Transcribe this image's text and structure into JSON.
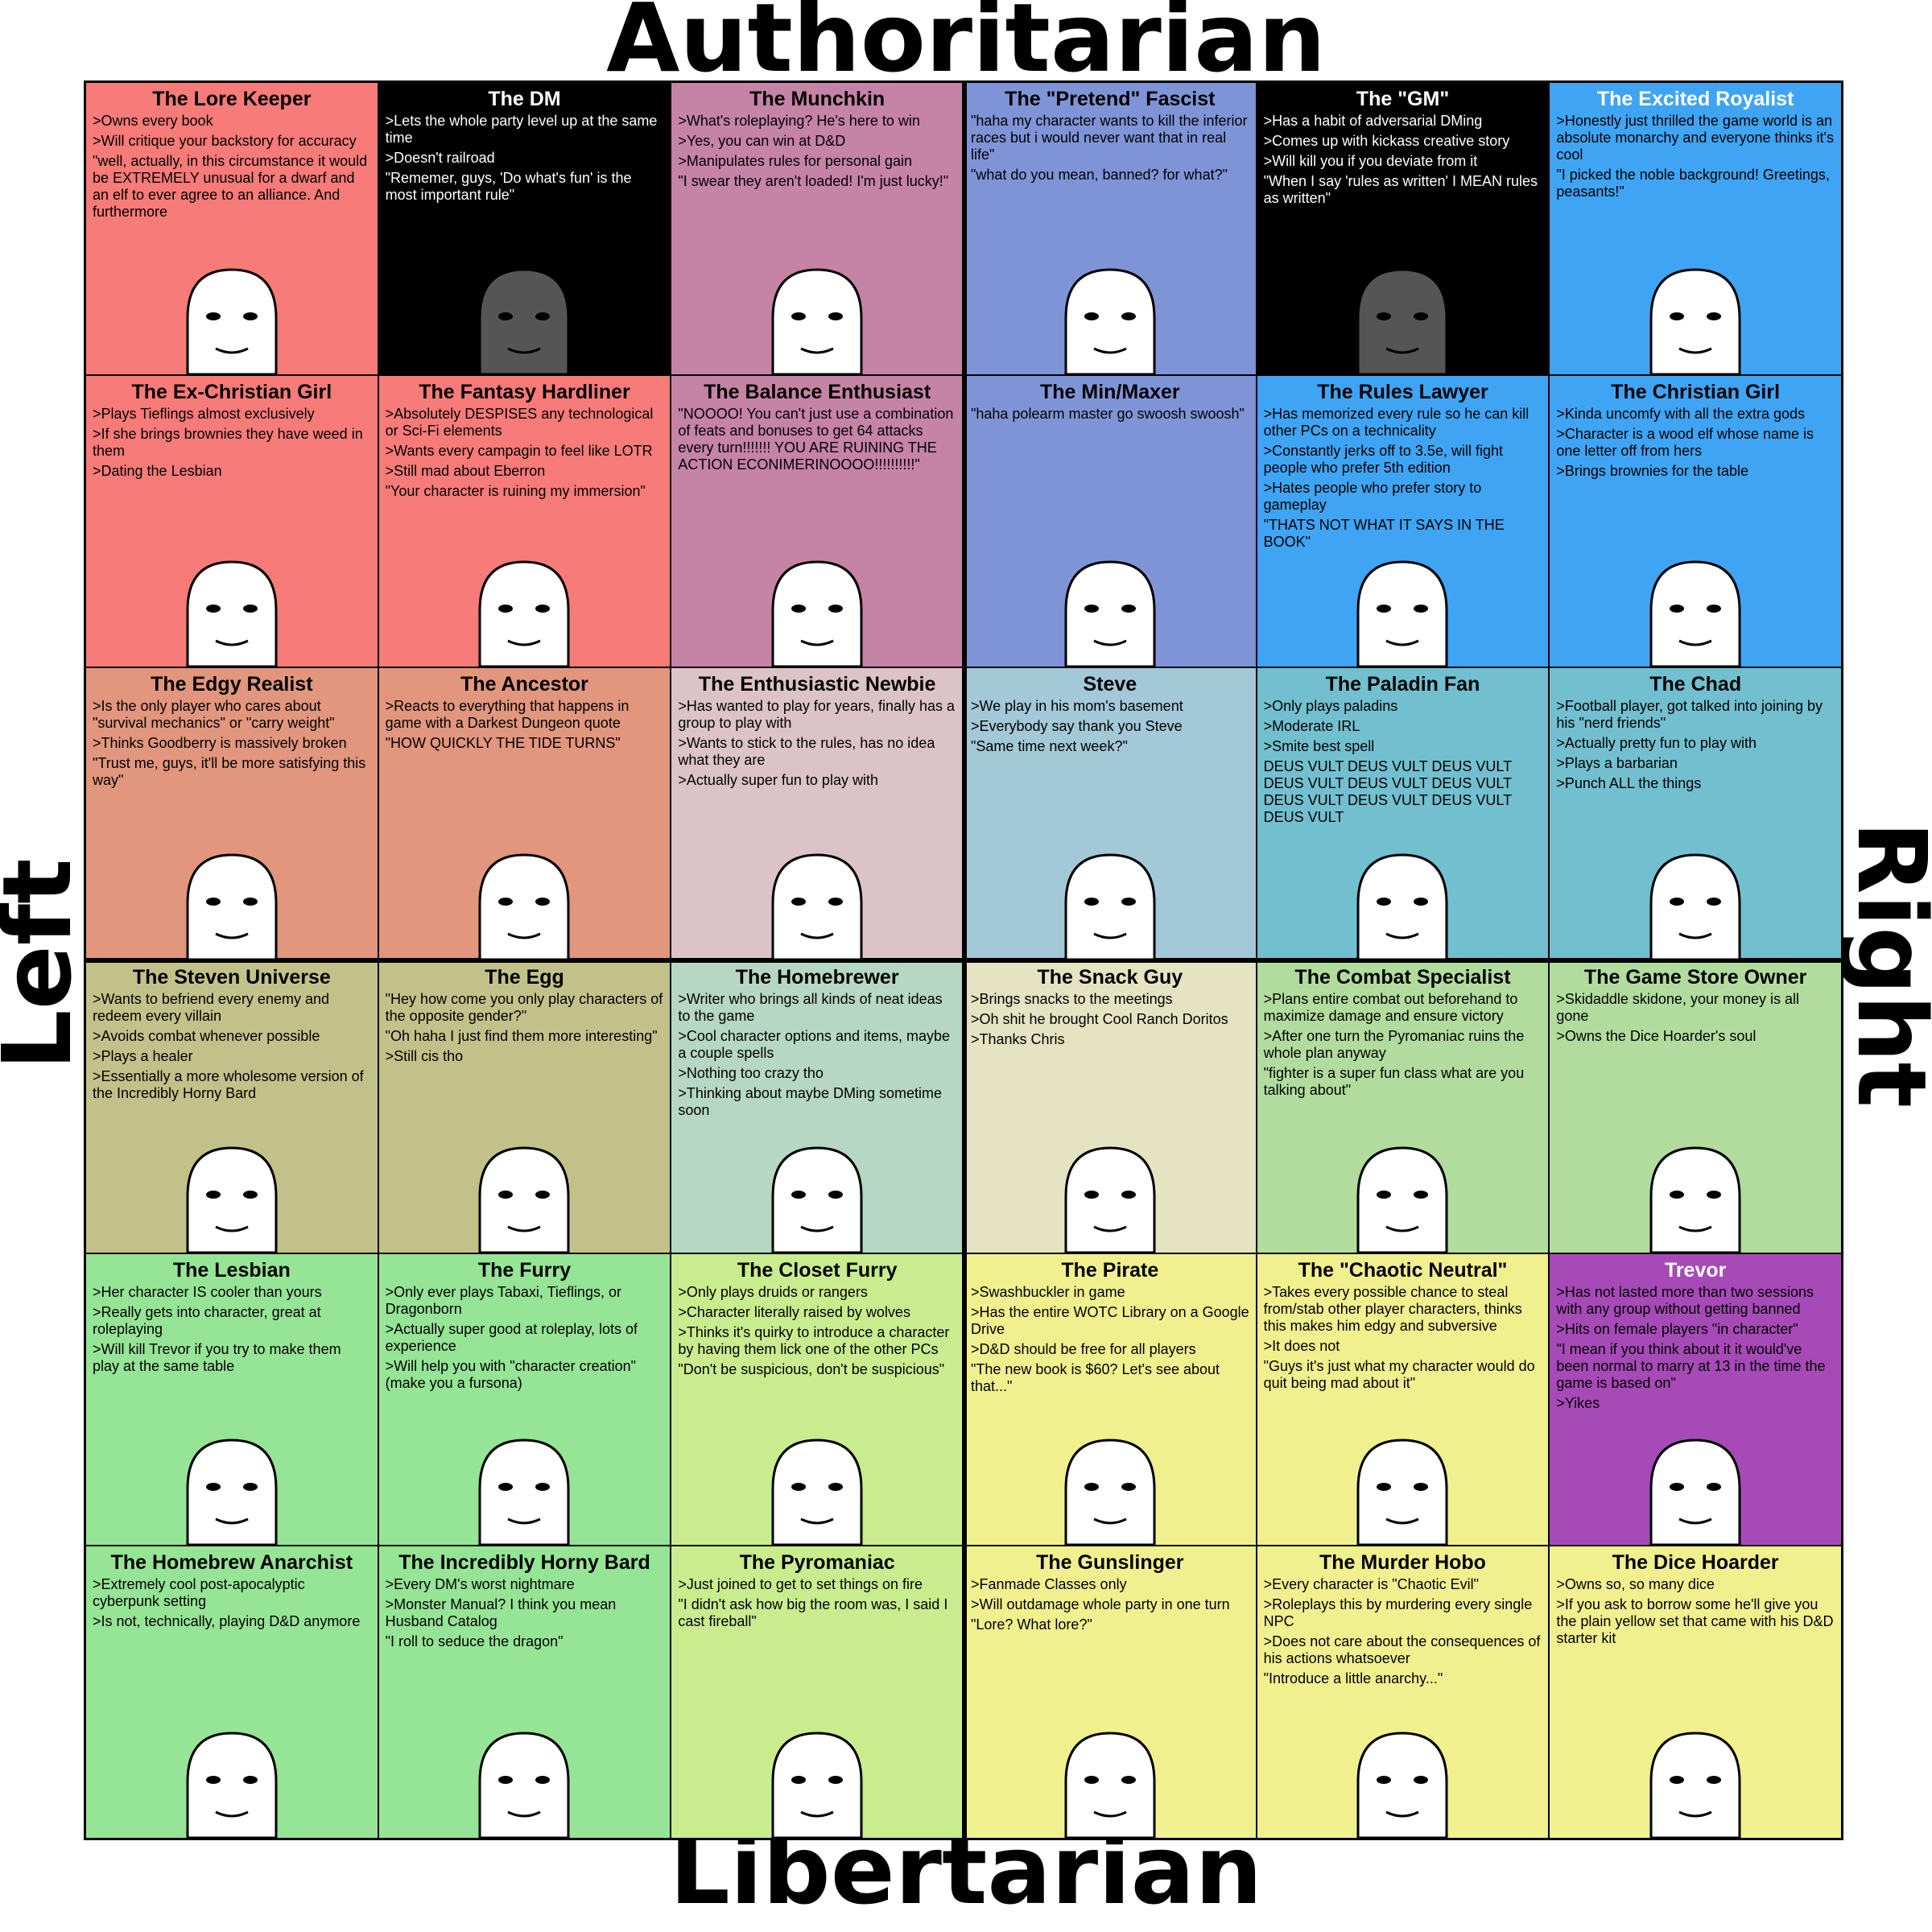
{
  "axes": {
    "top": "Authoritarian",
    "bottom": "Libertarian",
    "left": "Left",
    "right": "Right"
  },
  "cells": [
    {
      "title": "The Lore Keeper",
      "bg": "#f77b78",
      "lines": [
        ">Owns every book",
        ">Will critique your backstory for accuracy",
        "\"well, actually, in this circumstance it would be EXTREMELY unusual for a dwarf and an elf to ever agree to an alliance. And furthermore"
      ]
    },
    {
      "title": "The DM",
      "bg": "#000000",
      "dark": true,
      "lines": [
        ">Lets the whole party level up at the same time",
        ">Doesn't railroad",
        "\"Rememer, guys, 'Do what's fun' is the most important rule\""
      ]
    },
    {
      "title": "The Munchkin",
      "bg": "#c583a6",
      "lines": [
        ">What's roleplaying? He's here to win",
        ">Yes, you can win at D&D",
        ">Manipulates rules for personal gain",
        "\"I swear they aren't loaded! I'm just lucky!\""
      ]
    },
    {
      "title": "The \"Pretend\" Fascist",
      "bg": "#7f94d6",
      "lines": [
        "\"haha my character wants to kill the inferior races but i would never want that in real life\"",
        "\"what do you mean, banned? for what?\""
      ]
    },
    {
      "title": "The \"GM\"",
      "bg": "#000000",
      "dark": true,
      "lines": [
        ">Has a habit of adversarial DMing",
        ">Comes up with kickass creative story",
        ">Will kill you if you deviate from it",
        "\"When I say 'rules as written' I MEAN rules as written\""
      ]
    },
    {
      "title": "The Excited Royalist",
      "bg": "#3fa4f4",
      "lightTitle": true,
      "lines": [
        ">Honestly just thrilled the game world is an absolute monarchy and everyone thinks it's cool",
        "\"I picked the noble background! Greetings, peasants!\""
      ]
    },
    {
      "title": "The Ex-Christian Girl",
      "bg": "#f77b78",
      "lines": [
        ">Plays Tieflings almost exclusively",
        ">If she brings brownies they have weed in them",
        ">Dating the Lesbian"
      ]
    },
    {
      "title": "The Fantasy Hardliner",
      "bg": "#f77b78",
      "lines": [
        ">Absolutely DESPISES any technological or Sci-Fi elements",
        ">Wants every campagin to feel like LOTR",
        ">Still mad about Eberron",
        "\"Your character is ruining my immersion\""
      ]
    },
    {
      "title": "The Balance Enthusiast",
      "bg": "#c583a6",
      "lines": [
        "\"NOOOO! You can't just use a combination of feats and bonuses to get 64 attacks every turn!!!!!!! YOU ARE RUINING THE ACTION ECONIMERINOOOO!!!!!!!!!!\""
      ]
    },
    {
      "title": "The Min/Maxer",
      "bg": "#7f94d6",
      "lines": [
        "\"haha polearm master go swoosh swoosh\""
      ]
    },
    {
      "title": "The Rules Lawyer",
      "bg": "#3fa4f4",
      "lines": [
        ">Has memorized every rule so he can kill other PCs on a technicality",
        ">Constantly jerks off to 3.5e, will fight people who prefer 5th edition",
        ">Hates people who prefer story to gameplay",
        "\"THATS NOT WHAT IT SAYS IN THE BOOK\""
      ]
    },
    {
      "title": "The Christian Girl",
      "bg": "#3fa4f4",
      "lines": [
        ">Kinda uncomfy with all the extra gods",
        ">Character is a wood elf whose name is one letter off from hers",
        ">Brings brownies for the table"
      ]
    },
    {
      "title": "The Edgy Realist",
      "bg": "#e1967d",
      "lines": [
        ">Is the only player who cares about \"survival mechanics\" or \"carry weight\"",
        ">Thinks Goodberry is massively broken",
        "\"Trust me, guys, it'll be more satisfying this way\""
      ]
    },
    {
      "title": "The Ancestor",
      "bg": "#e1967d",
      "lines": [
        ">Reacts to everything that happens in game with a Darkest Dungeon quote",
        "\"HOW QUICKLY THE TIDE TURNS\""
      ]
    },
    {
      "title": "The Enthusiastic Newbie",
      "bg": "#dcc3c8",
      "lines": [
        ">Has wanted to play for years, finally has a group to play with",
        ">Wants to stick to the rules, has no idea what they are",
        ">Actually super fun to play with"
      ]
    },
    {
      "title": "Steve",
      "bg": "#a3c8d8",
      "lines": [
        ">We play in his mom's basement",
        ">Everybody say thank you Steve",
        "\"Same time next week?\""
      ]
    },
    {
      "title": "The Paladin Fan",
      "bg": "#72bfcf",
      "lines": [
        ">Only plays paladins",
        ">Moderate IRL",
        ">Smite best spell",
        "DEUS VULT DEUS VULT DEUS VULT DEUS VULT DEUS VULT DEUS VULT DEUS VULT DEUS VULT DEUS VULT DEUS VULT"
      ]
    },
    {
      "title": "The Chad",
      "bg": "#72bfcf",
      "lines": [
        ">Football player, got talked into joining by his \"nerd friends\"",
        ">Actually pretty fun to play with",
        ">Plays a barbarian",
        ">Punch ALL the things"
      ]
    },
    {
      "title": "The Steven Universe",
      "bg": "#c3c18a",
      "lines": [
        ">Wants to befriend every enemy and redeem every villain",
        ">Avoids combat whenever possible",
        ">Plays a healer",
        ">Essentially a more wholesome version of the Incredibly Horny Bard"
      ]
    },
    {
      "title": "The Egg",
      "bg": "#c3c18a",
      "lines": [
        "\"Hey how come you only play characters of the opposite gender?\"",
        "\"Oh haha I just find them more interesting\"",
        ">Still cis tho"
      ]
    },
    {
      "title": "The Homebrewer",
      "bg": "#b6d7c3",
      "lines": [
        ">Writer who brings all kinds of neat ideas to the game",
        ">Cool character options and items, maybe a couple spells",
        ">Nothing too crazy tho",
        ">Thinking about maybe DMing sometime soon"
      ]
    },
    {
      "title": "The Snack Guy",
      "bg": "#e4e4c3",
      "lines": [
        ">Brings snacks to the meetings",
        ">Oh shit he brought Cool Ranch Doritos",
        ">Thanks Chris"
      ]
    },
    {
      "title": "The Combat Specialist",
      "bg": "#b2dc9d",
      "lines": [
        ">Plans entire combat out beforehand to maximize damage and ensure victory",
        ">After one turn the Pyromaniac ruins the whole plan anyway",
        "\"fighter is a super fun class what are you talking about\""
      ]
    },
    {
      "title": "The Game Store Owner",
      "bg": "#b2dc9d",
      "lines": [
        ">Skidaddle skidone, your money is all gone",
        ">Owns the Dice Hoarder's soul"
      ]
    },
    {
      "title": "The Lesbian",
      "bg": "#96e496",
      "lines": [
        ">Her character IS cooler than yours",
        ">Really gets into character, great at roleplaying",
        ">Will kill Trevor if you try to make them play at the same table"
      ]
    },
    {
      "title": "The Furry",
      "bg": "#96e496",
      "lines": [
        ">Only ever plays Tabaxi, Tieflings, or Dragonborn",
        ">Actually super good at roleplay, lots of experience",
        ">Will help you with \"character creation\" (make you a fursona)"
      ]
    },
    {
      "title": "The Closet Furry",
      "bg": "#c9ec8e",
      "lines": [
        ">Only plays druids or rangers",
        ">Character literally raised by wolves",
        ">Thinks it's quirky to introduce a character by having them lick one of the other PCs",
        "\"Don't be suspicious, don't be suspicious\""
      ]
    },
    {
      "title": "The Pirate",
      "bg": "#f0f08f",
      "lines": [
        ">Swashbuckler in game",
        ">Has the entire WOTC Library on a Google Drive",
        ">D&D should be free for all players",
        "\"The new book is $60? Let's see about that...\""
      ]
    },
    {
      "title": "The \"Chaotic Neutral\"",
      "bg": "#f0f08f",
      "lines": [
        ">Takes every possible chance to steal from/stab other player characters, thinks this makes him edgy and subversive",
        ">It does not",
        "\"Guys it's just what my character would do quit being mad about it\""
      ]
    },
    {
      "title": "Trevor",
      "bg": "#a64ab7",
      "lightTitle": true,
      "lines": [
        ">Has not lasted more than two sessions with any group without getting banned",
        ">Hits on female players \"in character\"",
        "\"I mean if you think about it it would've been normal to marry at 13 in the time the game is based on\"",
        ">Yikes"
      ]
    },
    {
      "title": "The Homebrew Anarchist",
      "bg": "#96e496",
      "lines": [
        ">Extremely cool post-apocalyptic cyberpunk setting",
        ">Is not, technically, playing D&D anymore"
      ]
    },
    {
      "title": "The Incredibly Horny Bard",
      "bg": "#96e496",
      "lines": [
        ">Every DM's worst nightmare",
        ">Monster Manual? I think you mean Husband Catalog",
        "\"I roll to seduce the dragon\""
      ]
    },
    {
      "title": "The Pyromaniac",
      "bg": "#c9ec8e",
      "lines": [
        ">Just joined to get to set things on fire",
        "\"I didn't ask how big the room was, I said I cast fireball\""
      ]
    },
    {
      "title": "The Gunslinger",
      "bg": "#f0f08f",
      "lines": [
        ">Fanmade Classes only",
        ">Will outdamage whole party in one turn",
        "\"Lore? What lore?\""
      ]
    },
    {
      "title": "The Murder Hobo",
      "bg": "#f0f08f",
      "lines": [
        ">Every character is \"Chaotic Evil\"",
        ">Roleplays this by murdering every single NPC",
        ">Does not care about the consequences of his actions whatsoever",
        "\"Introduce a little anarchy...\""
      ]
    },
    {
      "title": "The Dice Hoarder",
      "bg": "#f0f08f",
      "lines": [
        ">Owns so, so many dice",
        ">If you ask to borrow some he'll give you the plain yellow set that came with his D&D starter kit"
      ]
    }
  ]
}
